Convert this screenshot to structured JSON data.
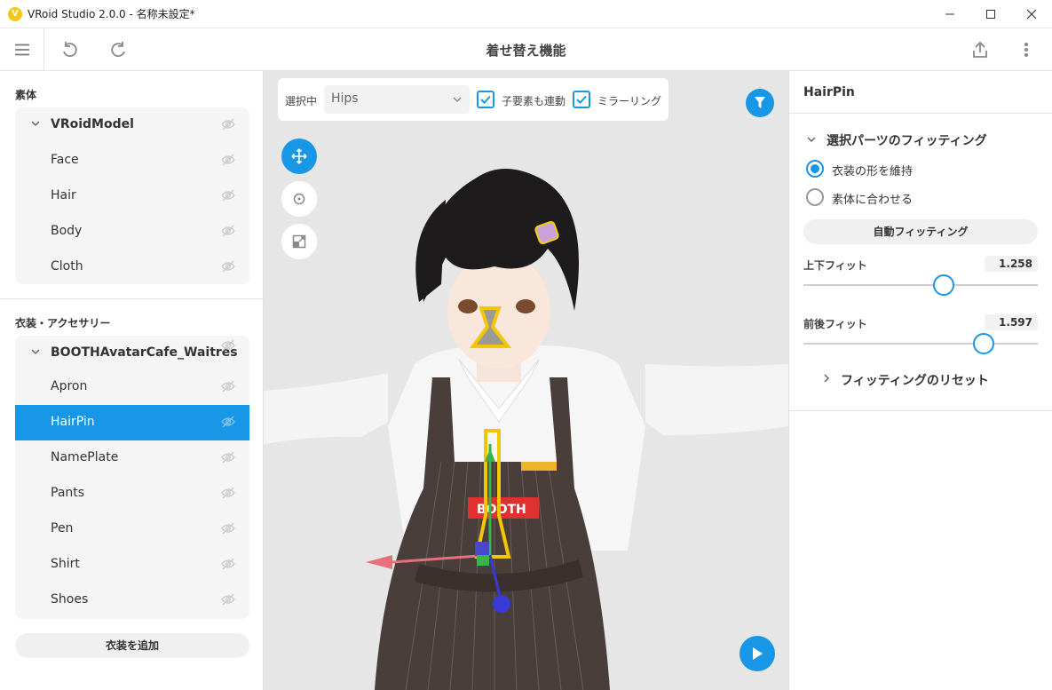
{
  "window": {
    "title": "VRoid Studio 2.0.0 - 名称未設定*",
    "logo_letter": "V"
  },
  "toolbar": {
    "title": "着せ替え機能"
  },
  "left": {
    "base_title": "素体",
    "base_tree": [
      {
        "label": "VRoidModel",
        "root": true
      },
      {
        "label": "Face"
      },
      {
        "label": "Hair"
      },
      {
        "label": "Body"
      },
      {
        "label": "Cloth"
      }
    ],
    "outfit_title": "衣装・アクセサリー",
    "outfit_tree": [
      {
        "label": "BOOTHAvatarCafe_Waitres",
        "root": true
      },
      {
        "label": "Apron"
      },
      {
        "label": "HairPin",
        "selected": true
      },
      {
        "label": "NamePlate"
      },
      {
        "label": "Pants"
      },
      {
        "label": "Pen"
      },
      {
        "label": "Shirt"
      },
      {
        "label": "Shoes"
      }
    ],
    "add_button": "衣装を追加"
  },
  "viewport": {
    "selecting_label": "選択中",
    "selected_bone": "Hips",
    "child_link_label": "子要素も連動",
    "child_link_checked": true,
    "mirror_label": "ミラーリング",
    "mirror_checked": true,
    "tools": [
      "move-tool-icon",
      "rotate-tool-icon",
      "scale-tool-icon"
    ],
    "active_tool": "move-tool-icon",
    "apron_badge": "BOOTH"
  },
  "right": {
    "panel_title": "HairPin",
    "fitting_section": "選択パーツのフィッティング",
    "options": [
      {
        "label": "衣装の形を維持",
        "checked": true
      },
      {
        "label": "素体に合わせる",
        "checked": false
      }
    ],
    "auto_fit_button": "自動フィッティング",
    "sliders": [
      {
        "label": "上下フィット",
        "value": "1.258",
        "position": 0.6
      },
      {
        "label": "前後フィット",
        "value": "1.597",
        "position": 0.77
      }
    ],
    "reset_label": "フィッティングのリセット"
  },
  "colors": {
    "accent": "#1797e6",
    "logo": "#f5c518",
    "viewport_bg": "#e6e6e6"
  }
}
